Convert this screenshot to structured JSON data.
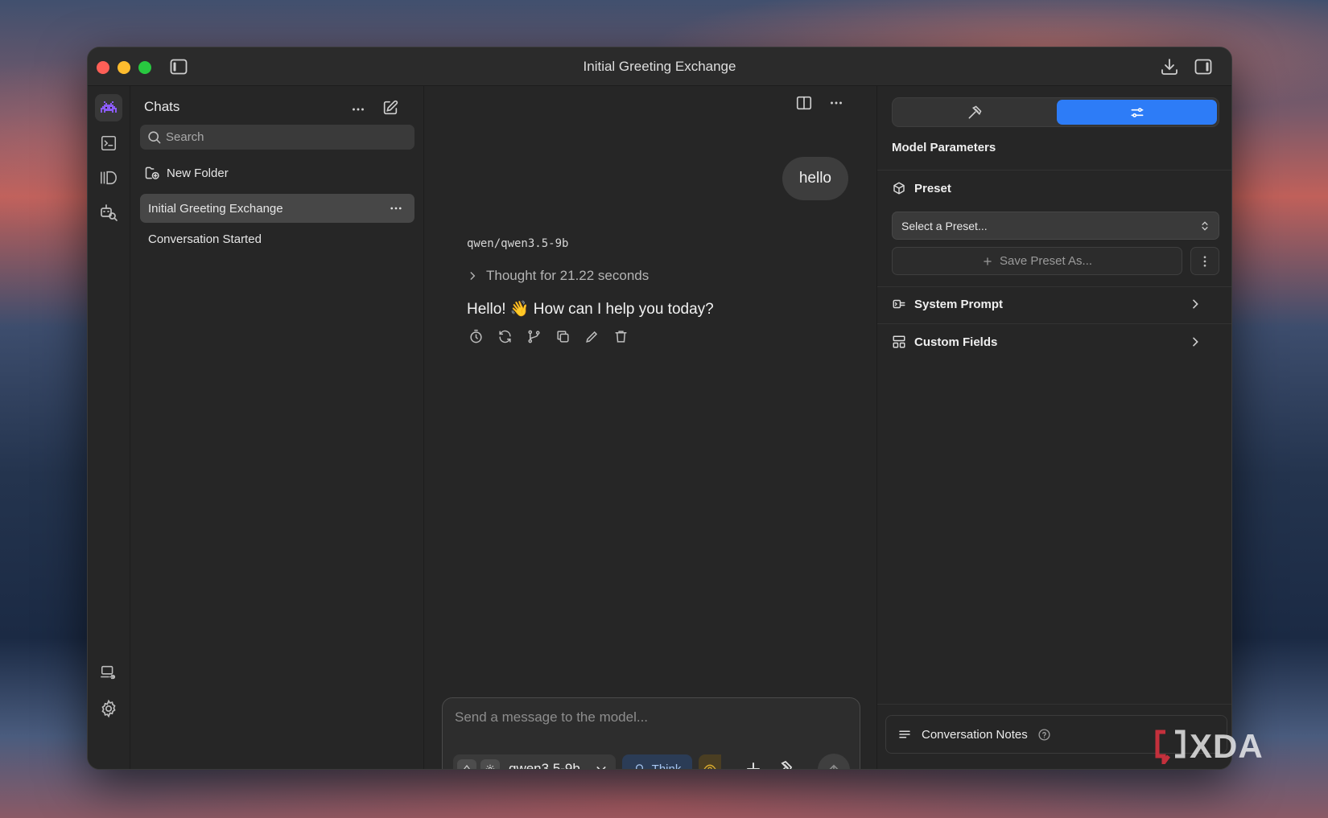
{
  "window": {
    "title": "Initial Greeting Exchange"
  },
  "sidebar": {
    "title": "Chats",
    "search_placeholder": "Search",
    "new_folder_label": "New Folder",
    "chats": [
      {
        "label": "Initial Greeting Exchange",
        "active": true
      },
      {
        "label": "Conversation Started",
        "active": false
      }
    ]
  },
  "conversation": {
    "user_message": "hello",
    "model_name": "qwen/qwen3.5-9b",
    "thought_label": "Thought for 21.22 seconds",
    "reply": "Hello! 👋 How can I help you today?"
  },
  "composer": {
    "placeholder": "Send a message to the model...",
    "model_label": "qwen3.5-9b",
    "think_label": "Think"
  },
  "params": {
    "title": "Model Parameters",
    "preset_label": "Preset",
    "preset_select": "Select a Preset...",
    "save_preset_label": "Save Preset As...",
    "system_prompt_label": "System Prompt",
    "custom_fields_label": "Custom Fields",
    "notes_label": "Conversation Notes"
  },
  "watermark": "XDA",
  "colors": {
    "accent": "#2d7cf7",
    "think_text": "#a9c8f2",
    "brand_purple": "#8b5cf6"
  }
}
